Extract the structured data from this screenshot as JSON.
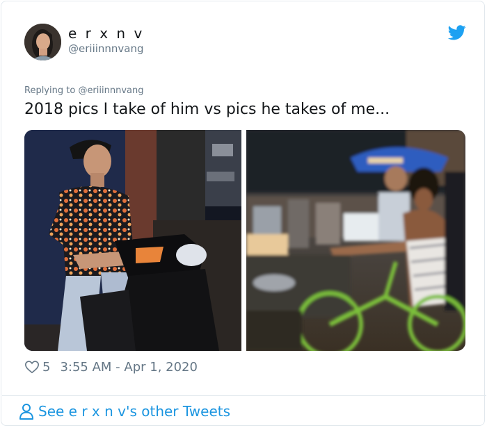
{
  "author": {
    "display_name": "e r x n v",
    "handle": "@eriiinnnvang",
    "avatar_icon": "user-avatar"
  },
  "reply": {
    "prefix": "Replying to",
    "mention": "@eriiinnnvang"
  },
  "tweet": {
    "text": "2018 pics I take of him vs pics he takes of me...",
    "likes": "5",
    "timestamp": "3:55 AM - Apr 1, 2020"
  },
  "media": {
    "left_photo": "man-on-scooter-photo",
    "right_photo": "woman-on-bike-blurry-photo"
  },
  "footer": {
    "see_more": "See e r x n v's other Tweets"
  },
  "colors": {
    "twitter_blue": "#1da1f2",
    "link_blue": "#1b95e0",
    "secondary_text": "#657786",
    "border": "#e1e8ed"
  }
}
